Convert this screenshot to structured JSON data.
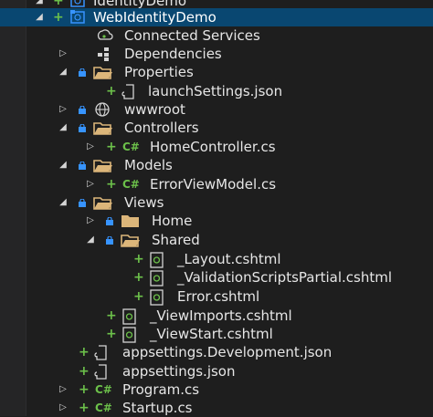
{
  "tree": {
    "partial_top": "IdentityDemo",
    "items": [
      {
        "label": "WebIdentityDemo",
        "icon": "project-icon",
        "selected": true
      },
      {
        "label": "Connected Services",
        "icon": "connected-services-icon"
      },
      {
        "label": "Dependencies",
        "icon": "dependencies-icon"
      },
      {
        "label": "Properties",
        "icon": "folder-icon"
      },
      {
        "label": "launchSettings.json",
        "icon": "json-file-icon"
      },
      {
        "label": "wwwroot",
        "icon": "globe-icon"
      },
      {
        "label": "Controllers",
        "icon": "folder-icon"
      },
      {
        "label": "HomeController.cs",
        "icon": "csharp-file-icon",
        "icon_text": "C#"
      },
      {
        "label": "Models",
        "icon": "folder-icon"
      },
      {
        "label": "ErrorViewModel.cs",
        "icon": "csharp-file-icon",
        "icon_text": "C#"
      },
      {
        "label": "Views",
        "icon": "folder-icon"
      },
      {
        "label": "Home",
        "icon": "folder-icon"
      },
      {
        "label": "Shared",
        "icon": "folder-icon"
      },
      {
        "label": "_Layout.cshtml",
        "icon": "razor-file-icon"
      },
      {
        "label": "_ValidationScriptsPartial.cshtml",
        "icon": "razor-file-icon"
      },
      {
        "label": "Error.cshtml",
        "icon": "razor-file-icon"
      },
      {
        "label": "_ViewImports.cshtml",
        "icon": "razor-file-icon"
      },
      {
        "label": "_ViewStart.cshtml",
        "icon": "razor-file-icon"
      },
      {
        "label": "appsettings.Development.json",
        "icon": "json-file-icon"
      },
      {
        "label": "appsettings.json",
        "icon": "json-file-icon"
      },
      {
        "label": "Program.cs",
        "icon": "csharp-file-icon",
        "icon_text": "C#"
      },
      {
        "label": "Startup.cs",
        "icon": "csharp-file-icon",
        "icon_text": "C#"
      }
    ]
  },
  "colors": {
    "background": "#1e1e1e",
    "selection": "#094771",
    "plus_sign": "#6cc04a",
    "lock": "#3794ff",
    "folder": "#dcb67a",
    "text": "#e6e6e6"
  }
}
